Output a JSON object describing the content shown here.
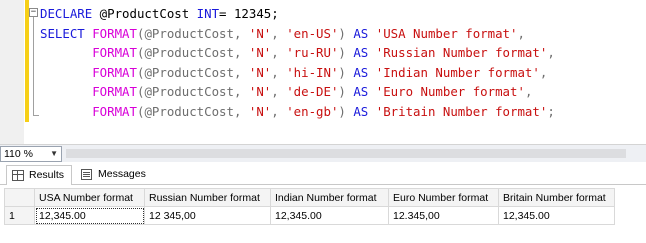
{
  "editor": {
    "lines": [
      [
        {
          "t": "DECLARE",
          "c": "kw"
        },
        {
          "t": " @ProductCost ",
          "c": ""
        },
        {
          "t": "INT",
          "c": "kw"
        },
        {
          "t": "= 12345;",
          "c": ""
        }
      ],
      [
        {
          "t": "SELECT ",
          "c": "kw"
        },
        {
          "t": "FORMAT",
          "c": "fn"
        },
        {
          "t": "(@ProductCost, ",
          "c": "gray"
        },
        {
          "t": "'N'",
          "c": "str"
        },
        {
          "t": ", ",
          "c": "gray"
        },
        {
          "t": "'en-US'",
          "c": "str"
        },
        {
          "t": ") ",
          "c": "gray"
        },
        {
          "t": "AS ",
          "c": "kw"
        },
        {
          "t": "'USA Number format'",
          "c": "str"
        },
        {
          "t": ",",
          "c": "gray"
        }
      ],
      [
        {
          "t": "       FORMAT",
          "c": "fn"
        },
        {
          "t": "(@ProductCost, ",
          "c": "gray"
        },
        {
          "t": "'N'",
          "c": "str"
        },
        {
          "t": ", ",
          "c": "gray"
        },
        {
          "t": "'ru-RU'",
          "c": "str"
        },
        {
          "t": ") ",
          "c": "gray"
        },
        {
          "t": "AS ",
          "c": "kw"
        },
        {
          "t": "'Russian Number format'",
          "c": "str"
        },
        {
          "t": ",",
          "c": "gray"
        }
      ],
      [
        {
          "t": "       FORMAT",
          "c": "fn"
        },
        {
          "t": "(@ProductCost, ",
          "c": "gray"
        },
        {
          "t": "'N'",
          "c": "str"
        },
        {
          "t": ", ",
          "c": "gray"
        },
        {
          "t": "'hi-IN'",
          "c": "str"
        },
        {
          "t": ") ",
          "c": "gray"
        },
        {
          "t": "AS ",
          "c": "kw"
        },
        {
          "t": "'Indian Number format'",
          "c": "str"
        },
        {
          "t": ",",
          "c": "gray"
        }
      ],
      [
        {
          "t": "       FORMAT",
          "c": "fn"
        },
        {
          "t": "(@ProductCost, ",
          "c": "gray"
        },
        {
          "t": "'N'",
          "c": "str"
        },
        {
          "t": ", ",
          "c": "gray"
        },
        {
          "t": "'de-DE'",
          "c": "str"
        },
        {
          "t": ") ",
          "c": "gray"
        },
        {
          "t": "AS ",
          "c": "kw"
        },
        {
          "t": "'Euro Number format'",
          "c": "str"
        },
        {
          "t": ",",
          "c": "gray"
        }
      ],
      [
        {
          "t": "       FORMAT",
          "c": "fn"
        },
        {
          "t": "(@ProductCost, ",
          "c": "gray"
        },
        {
          "t": "'N'",
          "c": "str"
        },
        {
          "t": ", ",
          "c": "gray"
        },
        {
          "t": "'en-gb'",
          "c": "str"
        },
        {
          "t": ") ",
          "c": "gray"
        },
        {
          "t": "AS ",
          "c": "kw"
        },
        {
          "t": "'Britain Number format'",
          "c": "str"
        },
        {
          "t": ";",
          "c": "gray"
        }
      ]
    ],
    "collapse_symbol": "−"
  },
  "zoom": {
    "value": "110 %",
    "arrow": "▼"
  },
  "tabs": [
    {
      "label": "Results",
      "icon": "grid-icon",
      "active": true
    },
    {
      "label": "Messages",
      "icon": "messages-icon",
      "active": false
    }
  ],
  "results": {
    "columns": [
      "USA Number format",
      "Russian Number format",
      "Indian Number format",
      "Euro Number format",
      "Britain Number format"
    ],
    "rows": [
      {
        "num": "1",
        "cells": [
          "12,345.00",
          "12 345,00",
          "12,345.00",
          "12.345,00",
          "12,345.00"
        ]
      }
    ]
  },
  "colors": {
    "keyword": "#1a1adb",
    "function": "#d800d8",
    "string": "#c81010",
    "punctuation": "#6e6e6e",
    "change_bar": "#f6cf17"
  }
}
